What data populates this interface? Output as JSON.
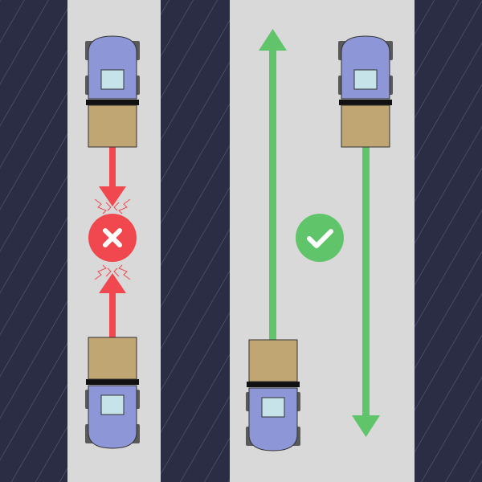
{
  "scene": {
    "colors": {
      "rack": "#2b2d45",
      "rack_stripe": "#5a5e78",
      "aisle": "#d9d9d9",
      "conflict": "#f0484e",
      "clear": "#5fc46a",
      "vehicle_body": "#8d96d6",
      "vehicle_window": "#c6e3ea",
      "wheel": "#5a5a5a",
      "fork": "#111111",
      "cargo": "#bfa673"
    },
    "icons": {
      "conflict": "close-icon",
      "clear": "check-icon"
    },
    "left_aisle": {
      "status": "conflict",
      "top_vehicle_direction": "down",
      "bottom_vehicle_direction": "up"
    },
    "right_aisle": {
      "status": "clear",
      "left_lane_direction": "up",
      "right_lane_direction": "down"
    }
  }
}
